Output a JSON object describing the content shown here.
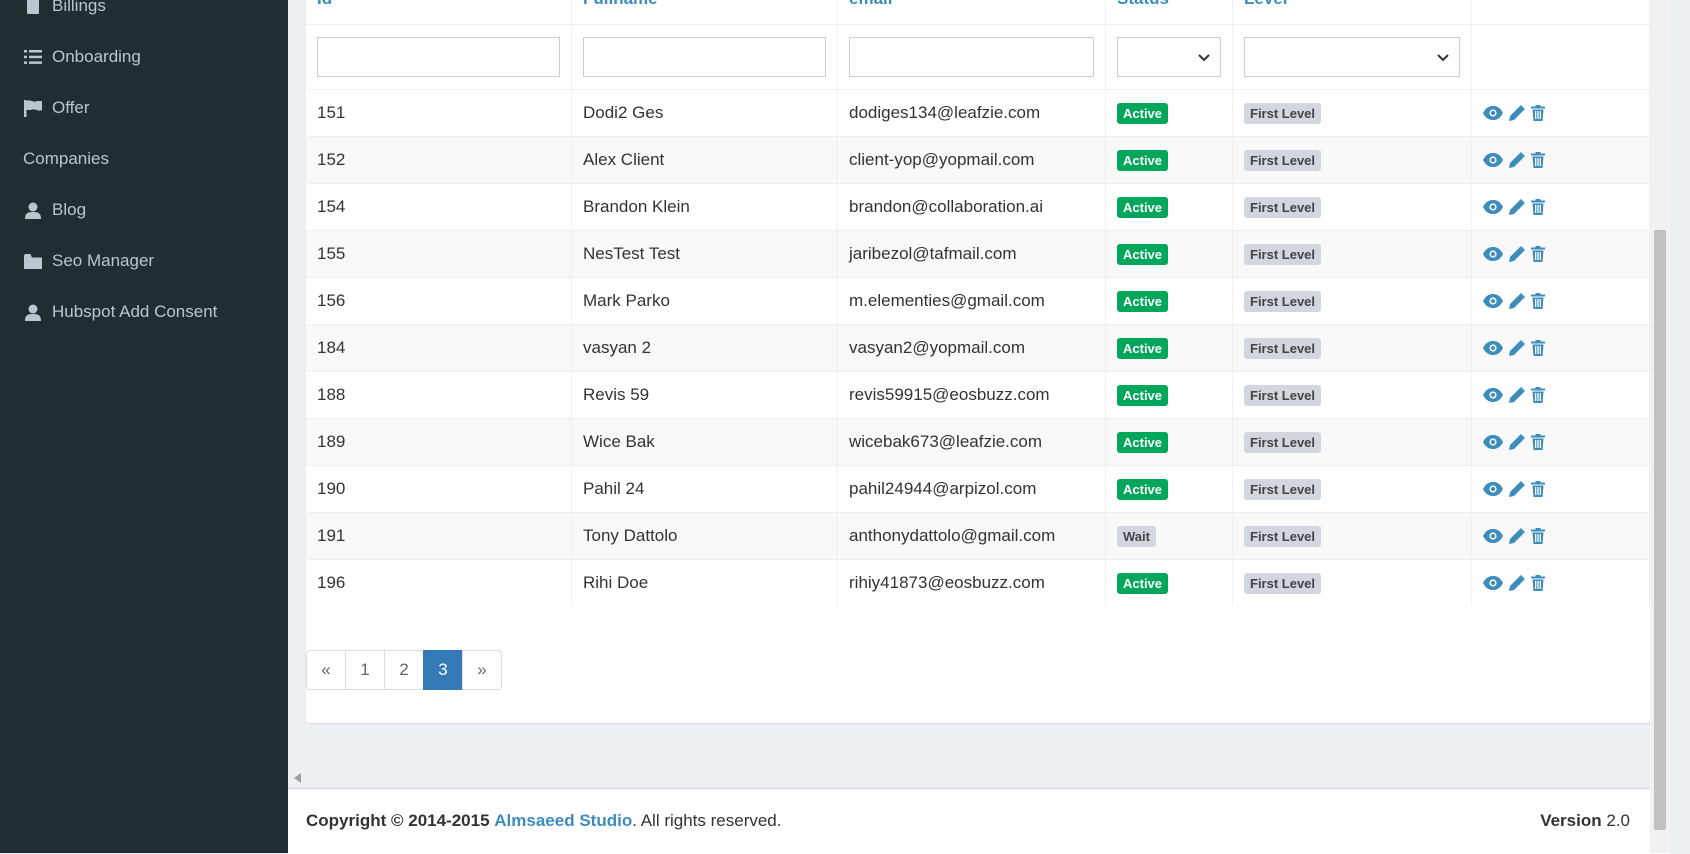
{
  "sidebar": {
    "items": [
      {
        "label": "Billings",
        "icon": "billing-icon"
      },
      {
        "label": "Onboarding",
        "icon": "list-icon"
      },
      {
        "label": "Offer",
        "icon": "flag-icon"
      },
      {
        "label": "Companies",
        "icon": ""
      },
      {
        "label": "Blog",
        "icon": "user-icon"
      },
      {
        "label": "Seo Manager",
        "icon": "folder-icon"
      },
      {
        "label": "Hubspot Add Consent",
        "icon": "user-icon"
      }
    ]
  },
  "table": {
    "headers": [
      "Id",
      "Fullname",
      "email",
      "Status",
      "Level"
    ],
    "rows": [
      {
        "id": "151",
        "fullname": "Dodi2 Ges",
        "email": "dodiges134@leafzie.com",
        "status": "Active",
        "level": "First Level"
      },
      {
        "id": "152",
        "fullname": "Alex Client",
        "email": "client-yop@yopmail.com",
        "status": "Active",
        "level": "First Level"
      },
      {
        "id": "154",
        "fullname": "Brandon Klein",
        "email": "brandon@collaboration.ai",
        "status": "Active",
        "level": "First Level"
      },
      {
        "id": "155",
        "fullname": "NesTest Test",
        "email": "jaribezol@tafmail.com",
        "status": "Active",
        "level": "First Level"
      },
      {
        "id": "156",
        "fullname": "Mark Parko",
        "email": "m.elementies@gmail.com",
        "status": "Active",
        "level": "First Level"
      },
      {
        "id": "184",
        "fullname": "vasyan 2",
        "email": "vasyan2@yopmail.com",
        "status": "Active",
        "level": "First Level"
      },
      {
        "id": "188",
        "fullname": "Revis 59",
        "email": "revis59915@eosbuzz.com",
        "status": "Active",
        "level": "First Level"
      },
      {
        "id": "189",
        "fullname": "Wice Bak",
        "email": "wicebak673@leafzie.com",
        "status": "Active",
        "level": "First Level"
      },
      {
        "id": "190",
        "fullname": "Pahil 24",
        "email": "pahil24944@arpizol.com",
        "status": "Active",
        "level": "First Level"
      },
      {
        "id": "191",
        "fullname": "Tony Dattolo",
        "email": "anthonydattolo@gmail.com",
        "status": "Wait",
        "level": "First Level"
      },
      {
        "id": "196",
        "fullname": "Rihi Doe",
        "email": "rihiy41873@eosbuzz.com",
        "status": "Active",
        "level": "First Level"
      }
    ]
  },
  "pagination": {
    "prev": "«",
    "pages": [
      "1",
      "2",
      "3"
    ],
    "active": "3",
    "next": "»"
  },
  "footer": {
    "copyright_prefix": "Copyright © 2014-2015",
    "company": "Almsaeed Studio",
    "suffix": ". All rights reserved.",
    "version_label": "Version",
    "version_value": "2.0"
  },
  "colors": {
    "sidebar_bg": "#222d32",
    "accent": "#3c8dbc",
    "active_badge": "#00a65a",
    "page_active": "#337ab7"
  }
}
